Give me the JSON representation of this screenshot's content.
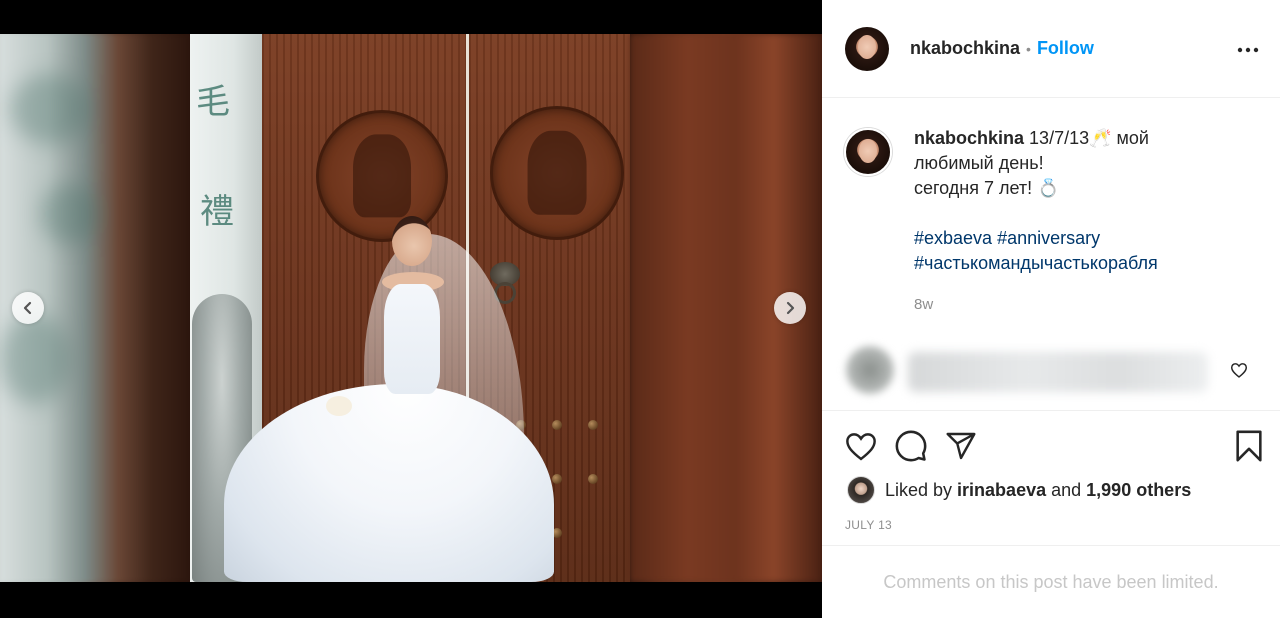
{
  "post": {
    "username": "nkabochkina",
    "separator": "•",
    "follow_label": "Follow",
    "caption": {
      "date": "13/7/13",
      "line1_emoji": "🥂",
      "line1_tail": " мой",
      "line2": "любимый день!",
      "line3_text": "сегодня 7 лет! ",
      "line3_emoji": "💍",
      "hashtags": [
        "#exbaeva #anniversary",
        "#частькомандычастькорабля"
      ]
    },
    "time_ago": "8w",
    "likes": {
      "prefix": "Liked by",
      "liker": "irinabaeva",
      "and": "and",
      "others": "1,990 others"
    },
    "date": "JULY 13",
    "comments_limited": "Comments on this post have been limited.",
    "carousel": {
      "slides": 6,
      "active_index": 1
    }
  },
  "icons": {
    "more": "more-horizontal-icon",
    "prev": "chevron-left-icon",
    "next": "chevron-right-icon",
    "like": "heart-icon",
    "comment": "comment-bubble-icon",
    "share": "paper-plane-icon",
    "save": "bookmark-icon"
  },
  "colors": {
    "accent": "#0095f6",
    "hashtag": "#00376b",
    "muted": "#8e8e8e"
  }
}
